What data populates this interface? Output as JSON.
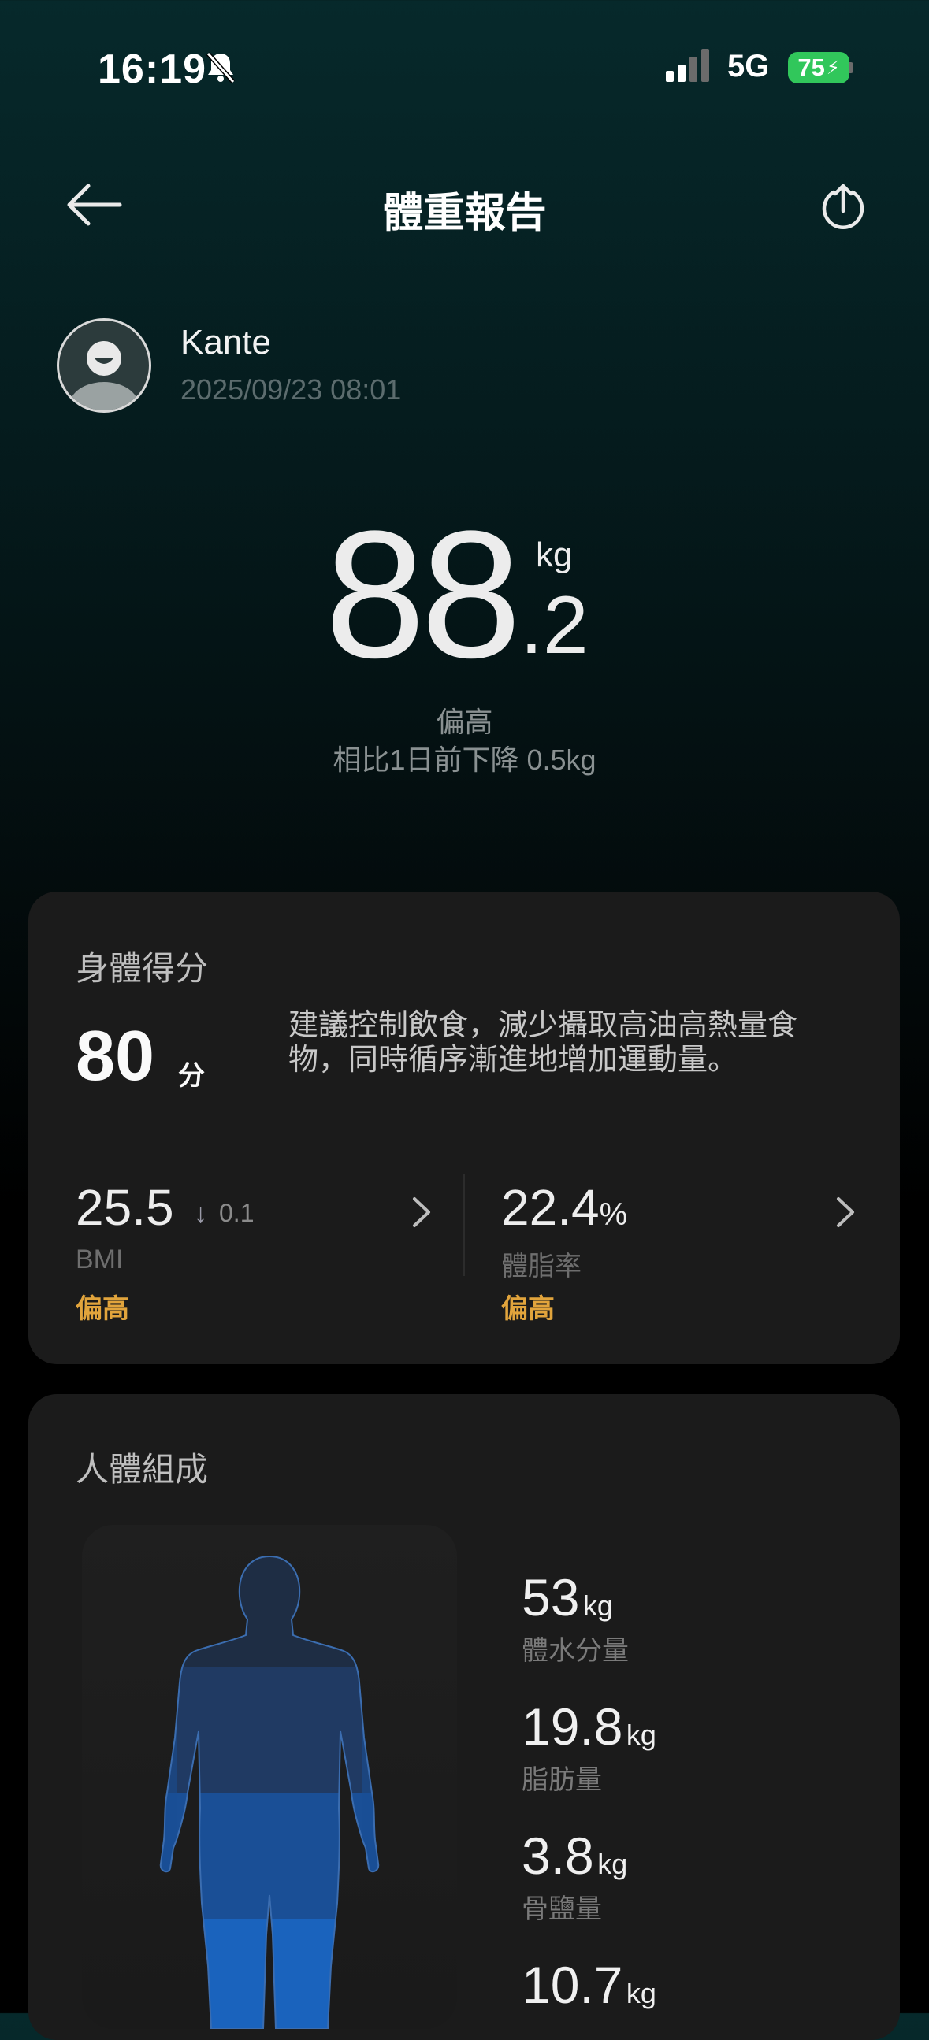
{
  "status_bar": {
    "time": "16:19",
    "network": "5G",
    "battery": "75"
  },
  "header": {
    "title": "體重報告"
  },
  "profile": {
    "name": "Kante",
    "datetime": "2025/09/23 08:01"
  },
  "weight": {
    "integer": "88",
    "decimal": ".2",
    "unit": "kg",
    "status": "偏高",
    "compare": "相比1日前下降 0.5kg"
  },
  "score_card": {
    "title": "身體得分",
    "score": "80",
    "score_unit": "分",
    "advice": "建議控制飲食，減少攝取高油高熱量食物，同時循序漸進地增加運動量。",
    "metrics": [
      {
        "value": "25.5",
        "delta": "0.1",
        "label": "BMI",
        "status": "偏高"
      },
      {
        "value": "22.4",
        "unit": "%",
        "label": "體脂率",
        "status": "偏高"
      }
    ]
  },
  "composition_card": {
    "title": "人體組成",
    "items": [
      {
        "value": "53",
        "unit": "kg",
        "label": "體水分量"
      },
      {
        "value": "19.8",
        "unit": "kg",
        "label": "脂肪量"
      },
      {
        "value": "3.8",
        "unit": "kg",
        "label": "骨鹽量"
      },
      {
        "value": "10.7",
        "unit": "kg",
        "label": ""
      }
    ]
  },
  "colors": {
    "accent_warning": "#e1a43c",
    "battery": "#31c75b",
    "body_blue": "#1e6fd0"
  }
}
